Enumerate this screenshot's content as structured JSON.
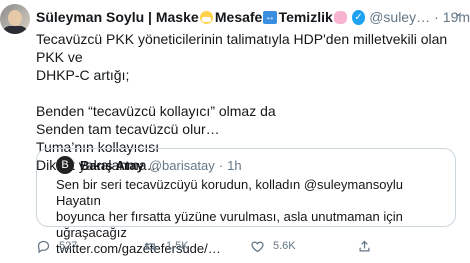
{
  "tweet": {
    "author_name": "Süleyman Soylu | Maske",
    "name_part2": "Mesafe",
    "name_part3": "Temizlik",
    "handle": "@suley…",
    "separator": "·",
    "time": "19m",
    "text_lines": [
      "Tecavüzcü PKK yöneticilerinin talimatıyla HDP'den milletvekili olan PKK ve",
      "DHKP-C artığı;",
      "",
      "Benden “tecavüzcü kollayıcı” olmaz da",
      "Senden tam tecavüzcü olur…",
      "Tuma’nın kollayıcısı",
      "Dikkat yakalanma…"
    ],
    "quoted": {
      "avatar_letter": "B",
      "name": "Barış Atay",
      "handle": "@barisatay",
      "separator": "·",
      "time": "1h",
      "text_lines": [
        "Sen bir seri tecavüzcüyü korudun, kolladın @suleymansoylu Hayatın",
        "boyunca her fırsatta yüzüne vurulması, asla unutmaman için uğraşacağız",
        "twitter.com/gazetefersude/…"
      ]
    },
    "actions": {
      "replies": "527",
      "retweets": "1.5K",
      "likes": "5.6K"
    }
  },
  "icons": [
    "mask-emoji-icon",
    "left-right-arrow-emoji-icon",
    "soap-emoji-icon",
    "verified-icon",
    "more-icon",
    "reply-icon",
    "retweet-icon",
    "like-icon",
    "share-icon"
  ]
}
